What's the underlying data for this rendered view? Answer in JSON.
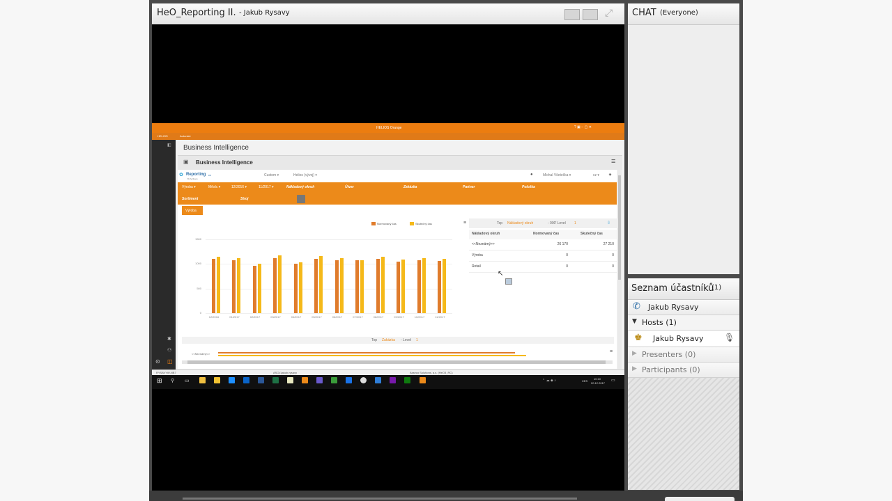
{
  "share": {
    "title": "HeO_Reporting II.",
    "subtitle": "- Jakub Rysavy"
  },
  "chat": {
    "title": "CHAT",
    "scope": "(Everyone)"
  },
  "attendees": {
    "title": "Seznam účastníků",
    "count": "(1)",
    "me": "Jakub Rysavy",
    "hosts_label": "Hosts (1)",
    "host_name": "Jakub Rysavy",
    "presenters_label": "Presenters (0)",
    "participants_label": "Participants (0)"
  },
  "screen": {
    "window_title": "HELIOS Orange",
    "tab_helios": "HELIOS",
    "tab_author": "Autorské",
    "page_header": "Business Intelligence",
    "panel_title": "Business Intelligence",
    "logo": "Reporting",
    "logo_suffix": "cz",
    "logo_sub": "BI Aplikace",
    "menu_custom": "Custom ▾",
    "menu_helios": "Helios (vývoj) ▾",
    "user": "Michal Všetečka ▾",
    "lang": "cz ▾",
    "filters_row1": [
      "Výroba ▾",
      "Měsíc ▾",
      "12/2016 ▾",
      "11/2017 ▾",
      "Nákladový okruh",
      "Útvar",
      "Zakázka",
      "Partner",
      "Položka"
    ],
    "filters_row2": [
      "Sortiment",
      "Stroj"
    ],
    "active_filter": "Výroba",
    "legend": [
      "Normovaný čas",
      "Skutečný čas"
    ],
    "table": {
      "title_prefix": "Top",
      "title_highlight": "Nákladový okruh",
      "title_suffix": "- 000' Level",
      "title_level": "1",
      "headers": [
        "Nákladový okruh",
        "Normovaný čas",
        "Skutečný čas"
      ],
      "rows": [
        [
          "<<Neznámý>>",
          "26 170",
          "27 210"
        ],
        [
          "Výroba",
          "0",
          "0"
        ],
        [
          "Retail",
          "0",
          "0"
        ]
      ]
    },
    "bottom_title_prefix": "Top",
    "bottom_title_highlight": "Zakázka",
    "bottom_title_suffix": "- Level",
    "bottom_title_level": "1",
    "bottom_row_label": "<<Neznámý>>",
    "status": [
      "RYSAVYW-NB7",
      "ASOL\\jakub.rysavy",
      "Asseco Solutions, a.s. (HeO3_RC)"
    ],
    "clock_time": "10:10",
    "clock_date": "20.12.2017",
    "tray_lang": "CES"
  },
  "chart_data": {
    "type": "bar",
    "categories": [
      "12/2016",
      "01/2017",
      "02/2017",
      "03/2017",
      "04/2017",
      "05/2017",
      "06/2017",
      "07/2017",
      "08/2017",
      "09/2017",
      "10/2017",
      "11/2017"
    ],
    "series": [
      {
        "name": "Normovaný čas",
        "values": [
          1100,
          1080,
          960,
          1120,
          1000,
          1110,
          1080,
          1070,
          1100,
          1050,
          1070,
          1060
        ]
      },
      {
        "name": "Skutečný čas",
        "values": [
          1150,
          1120,
          1010,
          1170,
          1040,
          1160,
          1120,
          1080,
          1150,
          1090,
          1120,
          1110
        ]
      }
    ],
    "yticks": [
      "0",
      "500",
      "1000",
      "1500"
    ],
    "ylim": [
      0,
      1500
    ],
    "colors": [
      "#e07c2c",
      "#f5b919"
    ]
  }
}
